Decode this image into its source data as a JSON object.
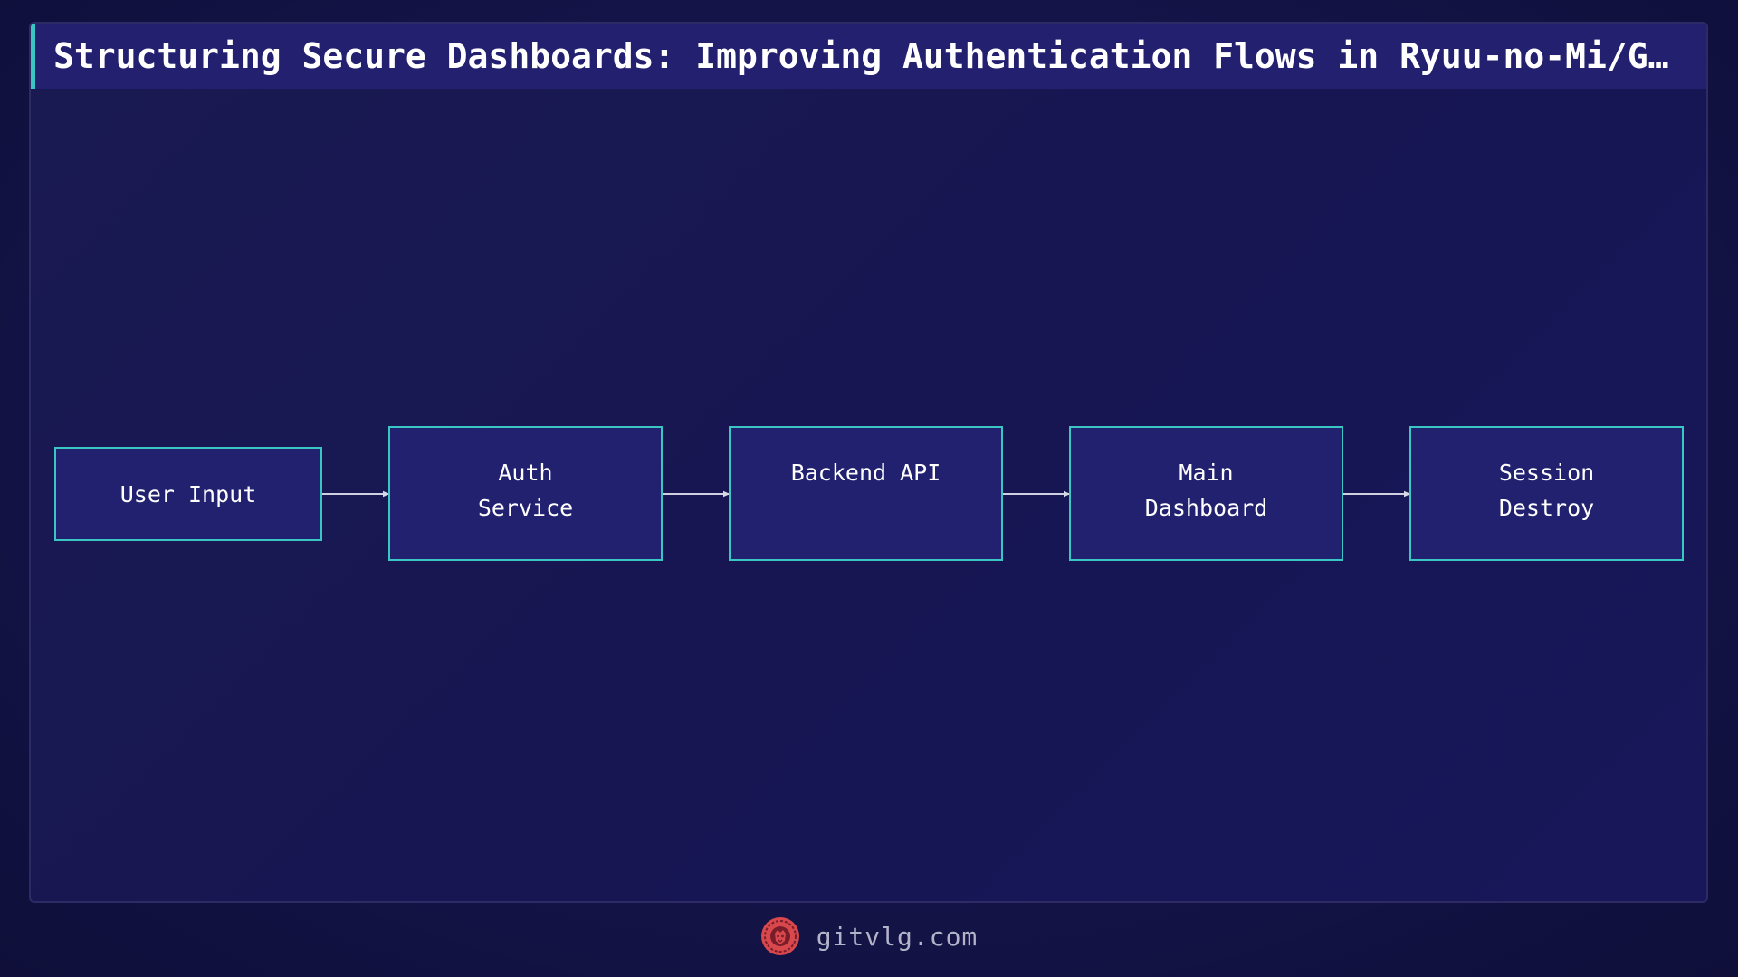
{
  "title": "Structuring Secure Dashboards: Improving Authentication Flows in Ryuu-no-Mi/Ges…",
  "diagram": {
    "nodes": [
      {
        "id": "user-input",
        "label": "User Input"
      },
      {
        "id": "auth-service",
        "label": "Auth\nService"
      },
      {
        "id": "backend-api",
        "label": "Backend API"
      },
      {
        "id": "main-dashboard",
        "label": "Main\nDashboard"
      },
      {
        "id": "session-destroy",
        "label": "Session\nDestroy"
      }
    ],
    "edges": [
      {
        "from": "user-input",
        "to": "auth-service"
      },
      {
        "from": "auth-service",
        "to": "backend-api"
      },
      {
        "from": "backend-api",
        "to": "main-dashboard"
      },
      {
        "from": "main-dashboard",
        "to": "session-destroy"
      }
    ]
  },
  "footer": {
    "logo_icon": "lion-logo-icon",
    "site": "gitvlg.com"
  },
  "colors": {
    "accent": "#3ac6c2",
    "node_fill": "#22216f",
    "title_bar": "#22206f",
    "background": "#151550",
    "logo": "#d8484c"
  }
}
